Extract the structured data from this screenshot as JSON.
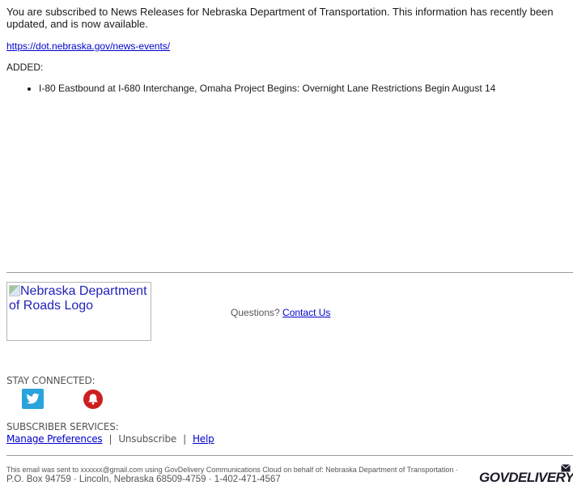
{
  "email": {
    "intro": "You are subscribed to News Releases for Nebraska Department of Transportation. This information has recently been updated, and is now available.",
    "news_link": "https://dot.nebraska.gov/news-events/",
    "added_label": "ADDED:",
    "added_items": [
      "I-80 Eastbound at I-680 Interchange, Omaha Project Begins: Overnight Lane Restrictions Begin August 14"
    ]
  },
  "footer": {
    "logo_alt": "Nebraska Department of Roads Logo",
    "questions_label": "Questions?",
    "contact_link": "Contact Us",
    "stay_connected_label": "STAY CONNECTED:",
    "social": [
      {
        "name": "twitter",
        "icon": "twitter-icon",
        "color": "#2aa3dc"
      },
      {
        "name": "alerts",
        "icon": "bell-icon",
        "color": "#cc1f1f"
      }
    ],
    "subscriber_services_label": "SUBSCRIBER SERVICES:",
    "manage_preferences": "Manage Preferences",
    "unsubscribe": "Unsubscribe",
    "help": "Help",
    "separator": "|",
    "sent_to_text": "This email was sent to xxxxxx@gmail.com using GovDelivery Communications Cloud on behalf of: Nebraska Department of Transportation · ",
    "address": "P.O. Box 94759 · Lincoln, Nebraska 68509-4759 · 1-402-471-4567",
    "brand": "GOVDELIVERY"
  },
  "colors": {
    "link": "#0000cc",
    "muted_text": "#555555",
    "twitter": "#2aa3dc",
    "alert": "#cc1f1f"
  }
}
